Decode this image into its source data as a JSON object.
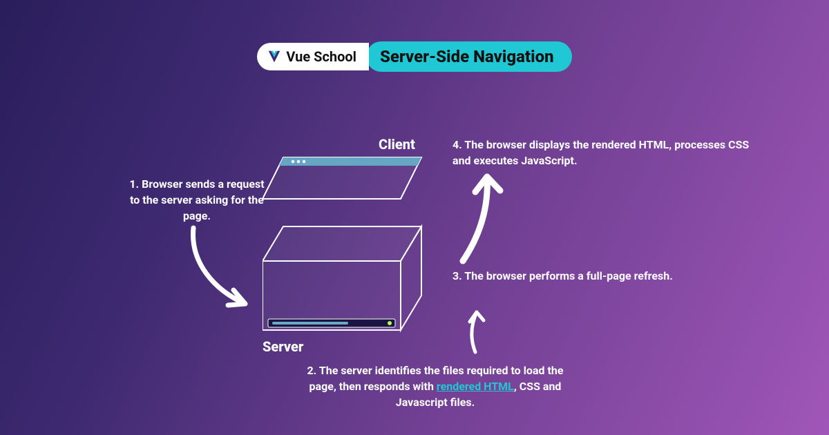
{
  "header": {
    "logo_text": "Vue School",
    "title": "Server-Side Navigation"
  },
  "labels": {
    "client": "Client",
    "server": "Server"
  },
  "steps": {
    "s1": "1. Browser sends a request to the server asking for the page.",
    "s2a": "2. The server identifies the files required to load the page, then responds with ",
    "s2_highlight": "rendered HTML",
    "s2b": ", CSS and Javascript files.",
    "s3": "3. The browser performs a full-page refresh.",
    "s4": "4. The browser displays the rendered HTML, processes CSS and executes JavaScript."
  }
}
